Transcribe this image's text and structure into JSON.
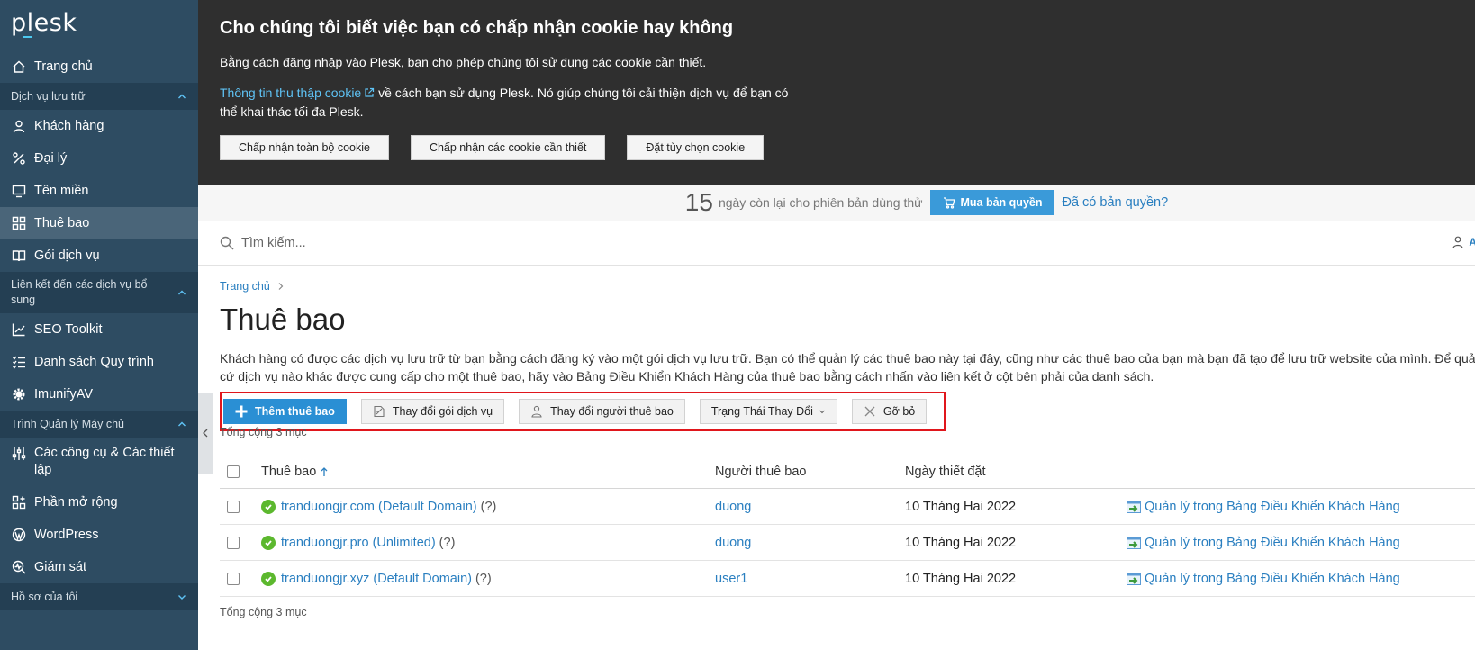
{
  "sidebar": {
    "logo": "plesk",
    "items": [
      {
        "type": "item",
        "label": "Trang chủ",
        "icon": "home-icon"
      },
      {
        "type": "group",
        "label": "Dịch vụ lưu trữ"
      },
      {
        "type": "item",
        "label": "Khách hàng",
        "icon": "user-icon"
      },
      {
        "type": "item",
        "label": "Đại lý",
        "icon": "percent-icon"
      },
      {
        "type": "item",
        "label": "Tên miền",
        "icon": "monitor-icon"
      },
      {
        "type": "item",
        "label": "Thuê bao",
        "icon": "grid-icon",
        "active": true
      },
      {
        "type": "item",
        "label": "Gói dịch vụ",
        "icon": "book-icon"
      },
      {
        "type": "group",
        "label": "Liên kết đến các dịch vụ bổ sung"
      },
      {
        "type": "item",
        "label": "SEO Toolkit",
        "icon": "chart-icon"
      },
      {
        "type": "item",
        "label": "Danh sách Quy trình",
        "icon": "checklist-icon"
      },
      {
        "type": "item",
        "label": "ImunifyAV",
        "icon": "gear-icon"
      },
      {
        "type": "group",
        "label": "Trình Quản lý Máy chủ"
      },
      {
        "type": "item",
        "label": "Các công cụ & Các thiết lập",
        "icon": "sliders-icon"
      },
      {
        "type": "item",
        "label": "Phần mở rộng",
        "icon": "extensions-icon"
      },
      {
        "type": "item",
        "label": "WordPress",
        "icon": "wordpress-icon"
      },
      {
        "type": "item",
        "label": "Giám sát",
        "icon": "monitoring-icon"
      },
      {
        "type": "group",
        "label": "Hồ sơ của tôi",
        "collapsed": true
      }
    ]
  },
  "cookie": {
    "title": "Cho chúng tôi biết việc bạn có chấp nhận cookie hay không",
    "text1": "Bằng cách đăng nhập vào Plesk, bạn cho phép chúng tôi sử dụng các cookie cần thiết.",
    "link": "Thông tin thu thập cookie",
    "text2": " về cách bạn sử dụng Plesk. Nó giúp chúng tôi cải thiện dịch vụ để bạn có thể khai thác tối đa Plesk.",
    "btn_accept_all": "Chấp nhận toàn bộ cookie",
    "btn_accept_needed": "Chấp nhận các cookie cần thiết",
    "btn_custom": "Đặt tùy chọn cookie"
  },
  "trial": {
    "days": "15",
    "text": "ngày còn lại cho phiên bản dùng thử",
    "buy": "Mua bản quyền",
    "have": "Đã có bản quyền?"
  },
  "search": {
    "placeholder": "Tìm kiếm...",
    "user_short": "A"
  },
  "content": {
    "breadcrumb": "Trang chủ",
    "title": "Thuê bao",
    "desc1": "Khách hàng có được các dịch vụ lưu trữ từ bạn bằng cách đăng ký vào một gói dịch vụ lưu trữ. Bạn có thể quản lý các thuê bao này tại đây, cũng như các thuê bao của bạn mà bạn đã tạo để lưu trữ website của mình. Để quản lý bất",
    "desc2": "cứ dịch vụ nào khác được cung cấp cho một thuê bao, hãy vào Bảng Điều Khiển Khách Hàng của thuê bao bằng cách nhấn vào liên kết ở cột bên phải của danh sách."
  },
  "toolbar": {
    "add": "Thêm thuê bao",
    "change_plan": "Thay đổi gói dịch vụ",
    "change_owner": "Thay đổi người thuê bao",
    "change_status": "Trạng Thái Thay Đổi",
    "remove": "Gỡ bỏ"
  },
  "table": {
    "total": "Tổng cộng 3 mục",
    "headers": {
      "subscription": "Thuê bao",
      "owner": "Người thuê bao",
      "date": "Ngày thiết đặt"
    },
    "rows": [
      {
        "name": "tranduongjr.com (Default Domain)",
        "hint": "(?)",
        "owner": "duong",
        "date": "10 Tháng Hai 2022",
        "action": "Quản lý trong Bảng Điều Khiển Khách Hàng"
      },
      {
        "name": "tranduongjr.pro (Unlimited)",
        "hint": "(?)",
        "owner": "duong",
        "date": "10 Tháng Hai 2022",
        "action": "Quản lý trong Bảng Điều Khiển Khách Hàng"
      },
      {
        "name": "tranduongjr.xyz (Default Domain)",
        "hint": "(?)",
        "owner": "user1",
        "date": "10 Tháng Hai 2022",
        "action": "Quản lý trong Bảng Điều Khiển Khách Hàng"
      }
    ]
  },
  "colors": {
    "sidebar": "#2e4c62",
    "accent": "#2a8fd4",
    "link": "#2a7fc0",
    "highlight": "#e0161c"
  }
}
